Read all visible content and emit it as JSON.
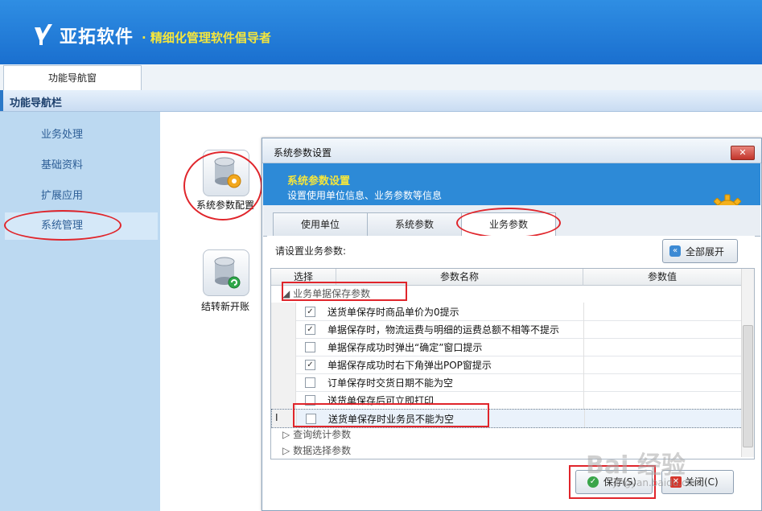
{
  "header": {
    "brand": "亚拓软件",
    "slogan": "· 精细化管理软件倡导者",
    "logo_icon": "yatuo-logo-icon"
  },
  "tabs": [
    {
      "label": "功能导航窗"
    }
  ],
  "navbar": {
    "title": "功能导航栏"
  },
  "sidebar": {
    "items": [
      {
        "label": "业务处理"
      },
      {
        "label": "基础资料"
      },
      {
        "label": "扩展应用"
      },
      {
        "label": "系统管理",
        "active": true
      }
    ]
  },
  "main": {
    "icons": [
      {
        "label": "系统参数配置",
        "icon": "database-gear-icon"
      },
      {
        "label": "结转新开账",
        "icon": "database-refresh-icon"
      }
    ]
  },
  "dialog": {
    "title": "系统参数设置",
    "close_icon": "close-icon",
    "banner_title": "系统参数设置",
    "banner_subtitle": "设置使用单位信息、业务参数等信息",
    "tabs": [
      {
        "label": "使用单位"
      },
      {
        "label": "系统参数"
      },
      {
        "label": "业务参数",
        "active": true
      }
    ],
    "prompt": "请设置业务参数:",
    "expand_all_label": "全部展开",
    "columns": {
      "select": "选择",
      "name": "参数名称",
      "value": "参数值"
    },
    "groups": [
      {
        "label": "业务单据保存参数",
        "expanded": true
      },
      {
        "label": "查询统计参数",
        "expanded": false
      },
      {
        "label": "数据选择参数",
        "expanded": false
      }
    ],
    "rows": [
      {
        "checked": true,
        "name": "送货单保存时商品单价为0提示"
      },
      {
        "checked": true,
        "name": "单据保存时，物流运费与明细的运费总额不相等不提示"
      },
      {
        "checked": false,
        "name": "单据保存成功时弹出“确定”窗口提示"
      },
      {
        "checked": true,
        "name": "单据保存成功时右下角弹出POP窗提示"
      },
      {
        "checked": false,
        "name": "订单保存时交货日期不能为空"
      },
      {
        "checked": false,
        "name": "送货单保存后可立即打印"
      },
      {
        "checked": false,
        "name": "送货单保存时业务员不能为空",
        "cursor": "I"
      }
    ],
    "save_label": "保存(S)",
    "close_label": "关闭(C)"
  },
  "watermark": {
    "text": "Bai 经验",
    "url": "jingyan.baidu.com"
  },
  "colors": {
    "header_blue": "#1a6fcf",
    "accent_yellow": "#f5e63c",
    "highlight_red": "#e0252b",
    "sidebar_bg": "#bcd9f1"
  }
}
